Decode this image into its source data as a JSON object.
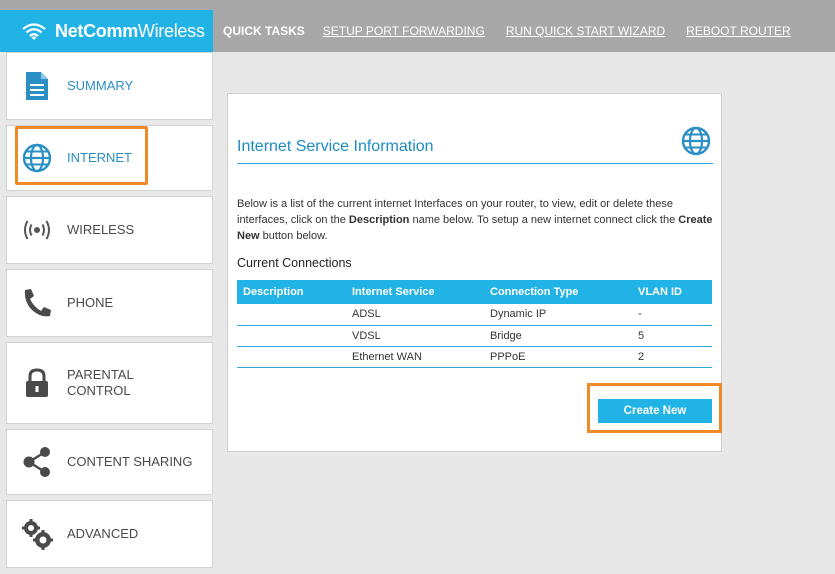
{
  "header": {
    "brand_bold": "NetComm",
    "brand_light": "Wireless",
    "quick_tasks_label": "QUICK TASKS",
    "links": [
      "SETUP PORT FORWARDING",
      "RUN QUICK START WIZARD",
      "REBOOT ROUTER"
    ],
    "accent": "#22b3e6"
  },
  "sidebar": {
    "items": [
      {
        "label": "SUMMARY",
        "icon": "document-icon"
      },
      {
        "label": "INTERNET",
        "icon": "globe-icon"
      },
      {
        "label": "WIRELESS",
        "icon": "wireless-icon"
      },
      {
        "label": "PHONE",
        "icon": "phone-icon"
      },
      {
        "label_line1": "PARENTAL",
        "label_line2": "CONTROL",
        "icon": "lock-icon"
      },
      {
        "label": "CONTENT SHARING",
        "icon": "share-icon"
      },
      {
        "label": "ADVANCED",
        "icon": "gears-icon"
      }
    ],
    "active": "INTERNET",
    "highlight_color": "#f08a24"
  },
  "main": {
    "title": "Internet Service Information",
    "description_part1": "Below is a list of the current internet Interfaces on your router, to view, edit or delete these interfaces, click on the ",
    "description_bold1": "Description",
    "description_part2": " name below. To setup a new internet connect click the ",
    "description_bold2": "Create New",
    "description_part3": " button below.",
    "current_connections_label": "Current Connections",
    "table": {
      "headers": [
        "Description",
        "Internet Service",
        "Connection Type",
        "VLAN ID"
      ],
      "rows": [
        [
          "",
          "ADSL",
          "Dynamic IP",
          "-"
        ],
        [
          "",
          "VDSL",
          "Bridge",
          "5"
        ],
        [
          "",
          "Ethernet WAN",
          "PPPoE",
          "2"
        ]
      ]
    },
    "create_button_label": "Create New"
  }
}
